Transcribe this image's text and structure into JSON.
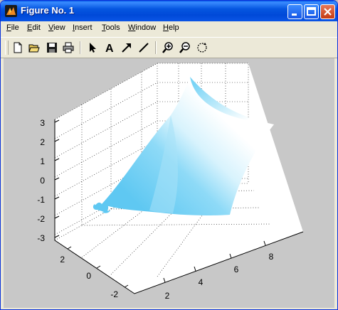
{
  "window": {
    "title": "Figure No. 1"
  },
  "menu": [
    {
      "label": "File",
      "u": "F",
      "rest": "ile"
    },
    {
      "label": "Edit",
      "u": "E",
      "rest": "dit"
    },
    {
      "label": "View",
      "u": "V",
      "rest": "iew"
    },
    {
      "label": "Insert",
      "u": "I",
      "rest": "nsert"
    },
    {
      "label": "Tools",
      "u": "T",
      "rest": "ools"
    },
    {
      "label": "Window",
      "u": "W",
      "rest": "indow"
    },
    {
      "label": "Help",
      "u": "H",
      "rest": "elp"
    }
  ],
  "toolbar": {
    "tools": [
      "new-figure-icon",
      "open-folder-icon",
      "save-icon",
      "print-icon",
      "select-arrow-icon",
      "insert-text-icon",
      "insert-arrow-icon",
      "insert-line-icon",
      "zoom-in-icon",
      "zoom-out-icon",
      "rotate-3d-icon"
    ],
    "text_tool_label": "A"
  },
  "plot": {
    "z_ticks": [
      "3",
      "2",
      "1",
      "0",
      "-1",
      "-2",
      "-3"
    ],
    "y_ticks": [
      "2",
      "0",
      "-2"
    ],
    "x_ticks": [
      "2",
      "4",
      "6",
      "8"
    ],
    "surface_color": "#6fd0f5",
    "background_color": "#ffffff"
  }
}
